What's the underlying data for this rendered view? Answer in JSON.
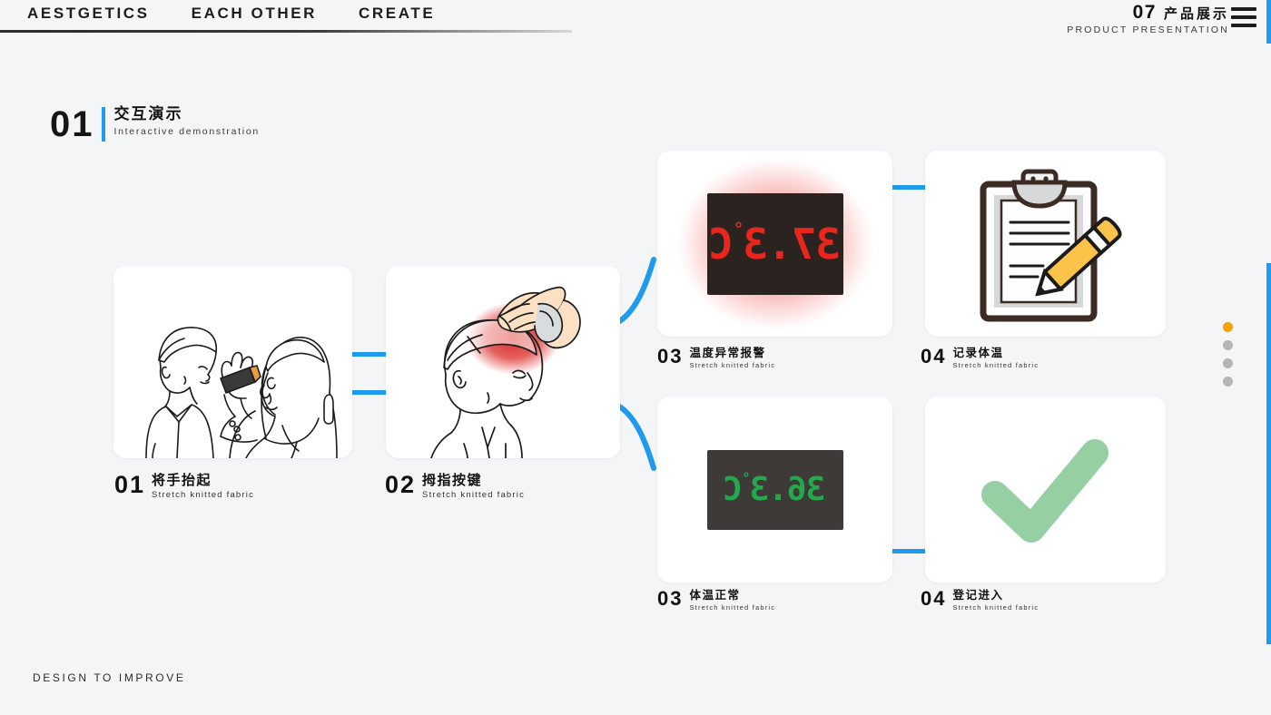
{
  "header": {
    "nav": [
      {
        "label": "AESTGETICS"
      },
      {
        "label": "EACH OTHER"
      },
      {
        "label": "CREATE"
      }
    ],
    "section_number": "07",
    "section_cn": "产品展示",
    "section_en": "PRODUCT PRESENTATION",
    "menu_icon": "hamburger-menu-icon"
  },
  "section": {
    "number": "01",
    "title_cn": "交互演示",
    "title_en": "Interactive demonstration",
    "accent_color": "#1e9aef"
  },
  "cards": [
    {
      "id": "card-01",
      "number": "01",
      "title_cn": "将手抬起",
      "title_en": "Stretch knitted fabric",
      "media": "illustration-two-people-thermometer"
    },
    {
      "id": "card-02",
      "number": "02",
      "title_cn": "拇指按键",
      "title_en": "Stretch knitted fabric",
      "media": "illustration-hand-on-forehead"
    },
    {
      "id": "card-03-alert",
      "number": "03",
      "title_cn": "温度异常报警",
      "title_en": "Stretch knitted fabric",
      "media": "led-display-red",
      "reading": "37.3",
      "degree": "°",
      "unit": "C",
      "color": "#e8261d"
    },
    {
      "id": "card-04-record",
      "number": "04",
      "title_cn": "记录体温",
      "title_en": "Stretch knitted fabric",
      "media": "clipboard-pencil-icon"
    },
    {
      "id": "card-03-normal",
      "number": "03",
      "title_cn": "体温正常",
      "title_en": "Stretch knitted fabric",
      "media": "led-display-green",
      "reading": "36.3",
      "degree": "°",
      "unit": "C",
      "color": "#23a94c"
    },
    {
      "id": "card-04-enter",
      "number": "04",
      "title_cn": "登记进入",
      "title_en": "Stretch knitted fabric",
      "media": "green-checkmark-icon"
    }
  ],
  "pagination": {
    "dots": [
      {
        "state": "active"
      },
      {
        "state": "inactive"
      },
      {
        "state": "inactive"
      },
      {
        "state": "inactive"
      }
    ],
    "active_color": "#f7a000",
    "inactive_color": "#b4b4b4"
  },
  "footer": {
    "text": "DESIGN TO IMPROVE"
  }
}
